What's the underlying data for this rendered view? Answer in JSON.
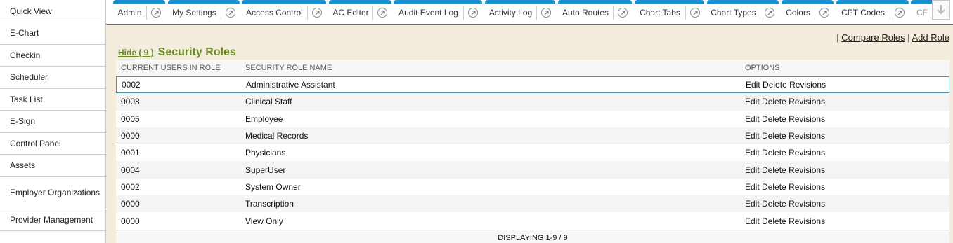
{
  "sidebar": {
    "items": [
      {
        "label": "Quick View"
      },
      {
        "label": "E-Chart"
      },
      {
        "label": "Checkin"
      },
      {
        "label": "Scheduler"
      },
      {
        "label": "Task List"
      },
      {
        "label": "E-Sign"
      },
      {
        "label": "Control Panel"
      },
      {
        "label": "Assets"
      },
      {
        "label": "Employer Organizations"
      },
      {
        "label": "Provider Management"
      }
    ]
  },
  "tabs": [
    {
      "label": "Admin"
    },
    {
      "label": "My Settings"
    },
    {
      "label": "Access Control"
    },
    {
      "label": "AC Editor"
    },
    {
      "label": "Audit Event Log"
    },
    {
      "label": "Activity Log"
    },
    {
      "label": "Auto Routes"
    },
    {
      "label": "Chart Tabs"
    },
    {
      "label": "Chart Types"
    },
    {
      "label": "Colors"
    },
    {
      "label": "CPT Codes"
    },
    {
      "label": "CF"
    }
  ],
  "toolbar": {
    "separator": "|",
    "compare_roles": "Compare Roles",
    "add_role": "Add Role"
  },
  "section": {
    "hide_label": "Hide ( 9 )",
    "title": "Security Roles"
  },
  "table": {
    "headers": {
      "users": "CURRENT USERS IN ROLE",
      "name": "SECURITY ROLE NAME",
      "options": "OPTIONS"
    },
    "option_labels": {
      "edit": "Edit",
      "delete": "Delete",
      "revisions": "Revisions"
    },
    "rows": [
      {
        "users": "0002",
        "name": "Administrative Assistant"
      },
      {
        "users": "0008",
        "name": "Clinical Staff"
      },
      {
        "users": "0005",
        "name": "Employee"
      },
      {
        "users": "0000",
        "name": "Medical Records"
      },
      {
        "users": "0001",
        "name": "Physicians"
      },
      {
        "users": "0004",
        "name": "SuperUser"
      },
      {
        "users": "0002",
        "name": "System Owner"
      },
      {
        "users": "0000",
        "name": "Transcription"
      },
      {
        "users": "0000",
        "name": "View Only"
      }
    ],
    "footer": "DISPLAYING 1-9 / 9"
  },
  "colors": {
    "tab_accent": "#1a8fd0",
    "title_green": "#6b8e23",
    "content_bg": "#f4ecdd"
  }
}
